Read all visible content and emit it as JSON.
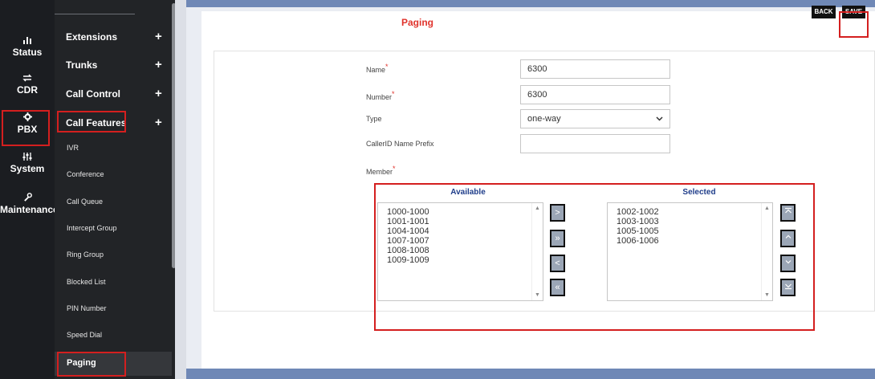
{
  "rail": {
    "items": [
      {
        "name": "Status",
        "icon": "bar-chart-icon"
      },
      {
        "name": "CDR",
        "icon": "arrows-exchange-icon"
      },
      {
        "name": "PBX",
        "icon": "gear-icon"
      },
      {
        "name": "System",
        "icon": "sliders-icon"
      },
      {
        "name": "Maintenance",
        "icon": "wrench-icon"
      }
    ]
  },
  "menu": {
    "items": [
      {
        "label": "Extensions"
      },
      {
        "label": "Trunks"
      },
      {
        "label": "Call Control"
      },
      {
        "label": "Call Features"
      }
    ],
    "plus": "+",
    "subitems": [
      {
        "label": "IVR"
      },
      {
        "label": "Conference"
      },
      {
        "label": "Call Queue"
      },
      {
        "label": "Intercept Group"
      },
      {
        "label": "Ring Group"
      },
      {
        "label": "Blocked List"
      },
      {
        "label": "PIN Number"
      },
      {
        "label": "Speed Dial"
      },
      {
        "label": "Paging"
      }
    ]
  },
  "page": {
    "title": "Paging",
    "back_label": "BACK",
    "save_label": "SAVE"
  },
  "form": {
    "required_mark": "*",
    "name_label": "Name",
    "name_value": "6300",
    "number_label": "Number",
    "number_value": "6300",
    "type_label": "Type",
    "type_value": "one-way",
    "callerid_label": "CallerID Name Prefix",
    "callerid_value": "",
    "member_label": "Member"
  },
  "members": {
    "available_label": "Available",
    "selected_label": "Selected",
    "available": [
      "1000-1000",
      "1001-1001",
      "1004-1004",
      "1007-1007",
      "1008-1008",
      "1009-1009"
    ],
    "selected": [
      "1002-1002",
      "1003-1003",
      "1005-1005",
      "1006-1006"
    ]
  },
  "colors": {
    "accent_red": "#e0332c",
    "sidebar_bg": "#1b1d21",
    "header_blue": "#6f88b6",
    "column_header_blue": "#1f3d8a"
  }
}
